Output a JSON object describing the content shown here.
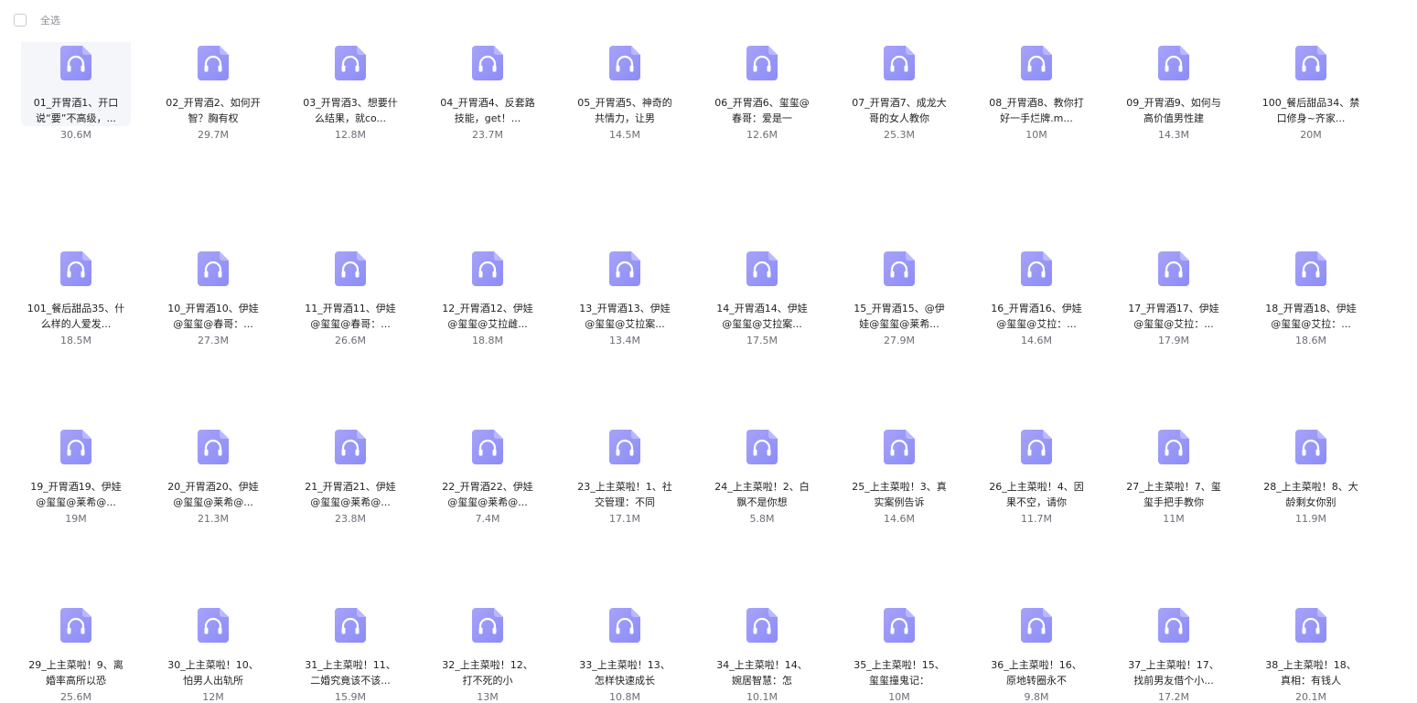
{
  "toolbar": {
    "select_all_label": "全选"
  },
  "colors": {
    "icon_bg": "#8c8cf7",
    "icon_bg_light": "#a6a3f9",
    "selected_bg": "#f5f6fa"
  },
  "icon_name": "headphones-icon",
  "files": [
    {
      "name": "01_开胃酒1、开口说“要”不高级，...",
      "size": "30.6M",
      "selected": true
    },
    {
      "name": "02_开胃酒2、如何开智？胸有权",
      "size": "29.7M"
    },
    {
      "name": "03_开胃酒3、想要什么结果，就co...",
      "size": "12.8M"
    },
    {
      "name": "04_开胃酒4、反套路技能，get！...",
      "size": "23.7M"
    },
    {
      "name": "05_开胃酒5、神奇的共情力，让男",
      "size": "14.5M"
    },
    {
      "name": "06_开胃酒6、玺玺@春哥：爱是一",
      "size": "12.6M"
    },
    {
      "name": "07_开胃酒7、成龙大哥的女人教你",
      "size": "25.3M"
    },
    {
      "name": "08_开胃酒8、教你打好一手烂牌.m...",
      "size": "10M"
    },
    {
      "name": "09_开胃酒9、如何与高价值男性建",
      "size": "14.3M"
    },
    {
      "name": "100_餐后甜品34、禁口修身~齐家...",
      "size": "20M"
    },
    {
      "name": "101_餐后甜品35、什么样的人爱发...",
      "size": "18.5M"
    },
    {
      "name": "10_开胃酒10、伊娃@玺玺@春哥：...",
      "size": "27.3M"
    },
    {
      "name": "11_开胃酒11、伊娃@玺玺@春哥：...",
      "size": "26.6M"
    },
    {
      "name": "12_开胃酒12、伊娃@玺玺@艾拉雌...",
      "size": "18.8M"
    },
    {
      "name": "13_开胃酒13、伊娃@玺玺@艾拉案...",
      "size": "13.4M"
    },
    {
      "name": "14_开胃酒14、伊娃@玺玺@艾拉案...",
      "size": "17.5M"
    },
    {
      "name": "15_开胃酒15、@伊娃@玺玺@莱希...",
      "size": "27.9M"
    },
    {
      "name": "16_开胃酒16、伊娃@玺玺@艾拉：...",
      "size": "14.6M"
    },
    {
      "name": "17_开胃酒17、伊娃@玺玺@艾拉：...",
      "size": "17.9M"
    },
    {
      "name": "18_开胃酒18、伊娃@玺玺@艾拉：...",
      "size": "18.6M"
    },
    {
      "name": "19_开胃酒19、伊娃@玺玺@莱希@...",
      "size": "19M"
    },
    {
      "name": "20_开胃酒20、伊娃@玺玺@莱希@...",
      "size": "21.3M"
    },
    {
      "name": "21_开胃酒21、伊娃@玺玺@莱希@...",
      "size": "23.8M"
    },
    {
      "name": "22_开胃酒22、伊娃@玺玺@莱希@...",
      "size": "7.4M"
    },
    {
      "name": "23_上主菜啦！1、社交管理：不同",
      "size": "17.1M"
    },
    {
      "name": "24_上主菜啦！2、白飘不是你想",
      "size": "5.8M"
    },
    {
      "name": "25_上主菜啦！3、真实案例告诉",
      "size": "14.6M"
    },
    {
      "name": "26_上主菜啦！4、因果不空，请你",
      "size": "11.7M"
    },
    {
      "name": "27_上主菜啦！7、玺玺手把手教你",
      "size": "11M"
    },
    {
      "name": "28_上主菜啦！8、大龄剩女你别",
      "size": "11.9M"
    },
    {
      "name": "29_上主菜啦！9、离婚率高所以恐",
      "size": "25.6M"
    },
    {
      "name": "30_上主菜啦！10、怕男人出轨所",
      "size": "12M"
    },
    {
      "name": "31_上主菜啦！11、二婚究竟该不该...",
      "size": "15.9M"
    },
    {
      "name": "32_上主菜啦！12、打不死的小",
      "size": "13M"
    },
    {
      "name": "33_上主菜啦！13、怎样快速成长",
      "size": "10.8M"
    },
    {
      "name": "34_上主菜啦！14、婉居智慧：怎",
      "size": "10.1M"
    },
    {
      "name": "35_上主菜啦！15、玺玺撞鬼记：",
      "size": "10M"
    },
    {
      "name": "36_上主菜啦！16、原地转圈永不",
      "size": "9.8M"
    },
    {
      "name": "37_上主菜啦！17、找前男友借个小...",
      "size": "17.2M"
    },
    {
      "name": "38_上主菜啦！18、真相：有钱人",
      "size": "20.1M"
    }
  ]
}
